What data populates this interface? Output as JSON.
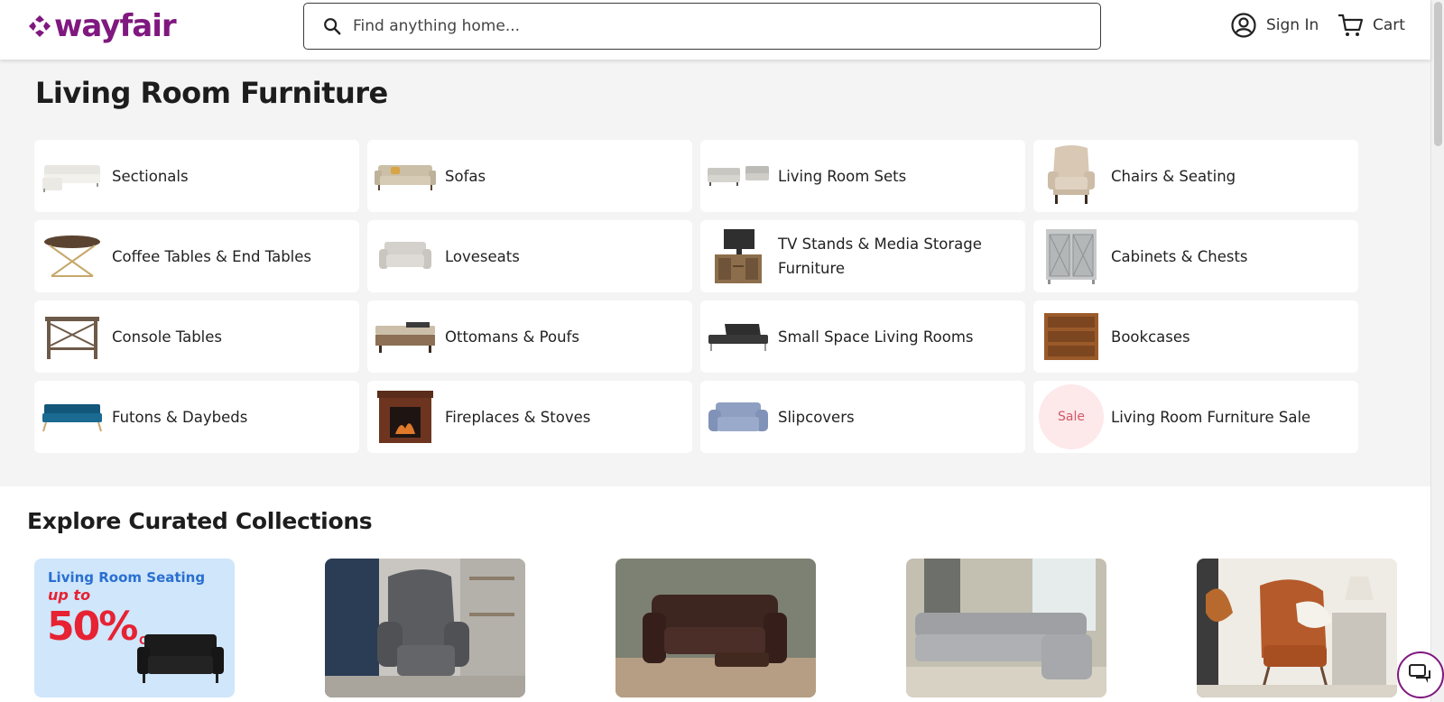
{
  "header": {
    "logo_text": "wayfair",
    "brand_color": "#7f187f",
    "search": {
      "placeholder": "Find anything home...",
      "value": ""
    },
    "sign_in_label": "Sign In",
    "cart_label": "Cart"
  },
  "page_title": "Living Room Furniture",
  "categories": [
    {
      "label": "Sectionals",
      "icon": "sectional-sofa-thumbnail"
    },
    {
      "label": "Sofas",
      "icon": "sofa-thumbnail"
    },
    {
      "label": "Living Room Sets",
      "icon": "living-room-set-thumbnail"
    },
    {
      "label": "Chairs & Seating",
      "icon": "wingback-chair-thumbnail"
    },
    {
      "label": "Coffee Tables & End Tables",
      "icon": "coffee-table-thumbnail"
    },
    {
      "label": "Loveseats",
      "icon": "loveseat-thumbnail"
    },
    {
      "label": "TV Stands & Media Storage Furniture",
      "icon": "tv-stand-thumbnail"
    },
    {
      "label": "Cabinets & Chests",
      "icon": "cabinet-thumbnail"
    },
    {
      "label": "Console Tables",
      "icon": "console-table-thumbnail"
    },
    {
      "label": "Ottomans & Poufs",
      "icon": "ottoman-thumbnail"
    },
    {
      "label": "Small Space Living Rooms",
      "icon": "futon-thumbnail"
    },
    {
      "label": "Bookcases",
      "icon": "bookcase-thumbnail"
    },
    {
      "label": "Futons & Daybeds",
      "icon": "futon-daybed-thumbnail"
    },
    {
      "label": "Fireplaces & Stoves",
      "icon": "fireplace-thumbnail"
    },
    {
      "label": "Slipcovers",
      "icon": "slipcover-thumbnail"
    },
    {
      "label": "Living Room Furniture Sale",
      "icon": "sale-badge"
    }
  ],
  "sale_badge_text": "Sale",
  "collections": {
    "title": "Explore Curated Collections",
    "promo": {
      "line1": "Living Room Seating",
      "line2": "up to",
      "percent": "50%",
      "off": "OFF"
    },
    "cards": [
      {
        "name": "power-lift-recliner-photo"
      },
      {
        "name": "leather-loveseat-recliner-photo"
      },
      {
        "name": "reclining-sectional-photo"
      },
      {
        "name": "accent-chair-photo"
      }
    ]
  }
}
